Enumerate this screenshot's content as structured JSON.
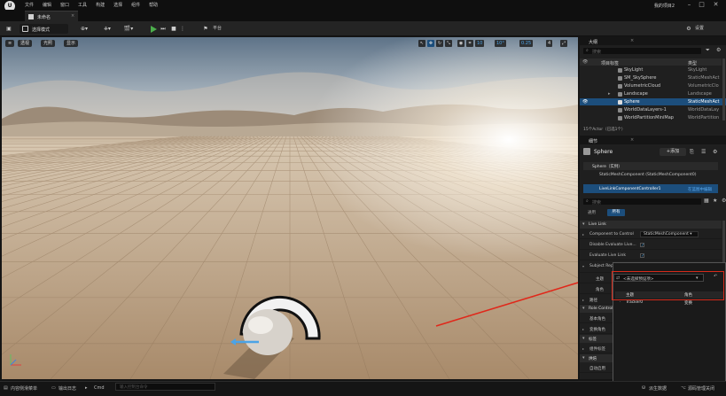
{
  "menu": {
    "items": [
      "文件",
      "编辑",
      "窗口",
      "工具",
      "构建",
      "选择",
      "组件",
      "帮助"
    ],
    "project": "我的项目2"
  },
  "tab": {
    "level": "未命名"
  },
  "toolbar": {
    "select_mode": "选择模式",
    "platform": "平台",
    "settings": "设置"
  },
  "viewport": {
    "perspective": "透视",
    "lit": "光照",
    "show": "显示",
    "grid_snap": "10",
    "rotation_snap": "10°",
    "scale_snap": "0.25",
    "camera_speed": "4"
  },
  "outliner": {
    "tab": "大纲",
    "search_placeholder": "搜索",
    "col_label": "项目标签",
    "col_type": "类型",
    "rows": [
      {
        "name": "SkyLight",
        "type": "SkyLight"
      },
      {
        "name": "SM_SkySphere",
        "type": "StaticMeshAct"
      },
      {
        "name": "VolumetricCloud",
        "type": "VolumetricClo"
      },
      {
        "name": "Landscape",
        "type": "Landscape"
      },
      {
        "name": "Sphere",
        "type": "StaticMeshAct"
      },
      {
        "name": "WorldDataLayers-1",
        "type": "WorldDataLay"
      },
      {
        "name": "WorldPartitionMiniMap",
        "type": "WorldPartition"
      }
    ],
    "footer": "15个Actor（已选1个）"
  },
  "details": {
    "tab": "细节",
    "actor_name": "Sphere",
    "add_label": "+添加",
    "instance": "Sphere（实例）",
    "component1": "StaticMeshComponent (StaticMeshComponent0)",
    "component2": "LiveLinkComponentController1",
    "edit_in_blueprint": "在蓝图中编辑",
    "search_placeholder": "搜索",
    "filter_general": "通用",
    "filter_all": "所有",
    "section_livelink": "Live Link",
    "component_to_control": "Component to Control",
    "component_value": "StaticMeshComponent",
    "disable_eval": "Disable Evaluate Live...",
    "evaluate_live_link": "Evaluate Live Link",
    "subject_representation": "Subject Representation",
    "subject_value": "Tracker0",
    "subject_sub": "任意格角色",
    "subject": "主题",
    "role": "角色",
    "sub_item": "路径",
    "section_role_control": "Role Controll",
    "basic_role": "基本角色",
    "transform_role": "变换角色",
    "section_tag": "标签",
    "component_tag": "组件标签",
    "section_cook": "烘焙",
    "auto_activate": "自动启用"
  },
  "popup": {
    "dropdown": "<未选择预设项>",
    "col_subject": "主题",
    "col_role": "角色",
    "entry_subject": "Tracker0",
    "entry_role": "变换"
  },
  "status": {
    "content_drawer": "内容侧滑菜单",
    "output_log": "输出日志",
    "cmd": "Cmd",
    "cmd_placeholder": "输入控制台命令",
    "derived_data": "派生数据",
    "source_control": "源码管理关闭"
  }
}
